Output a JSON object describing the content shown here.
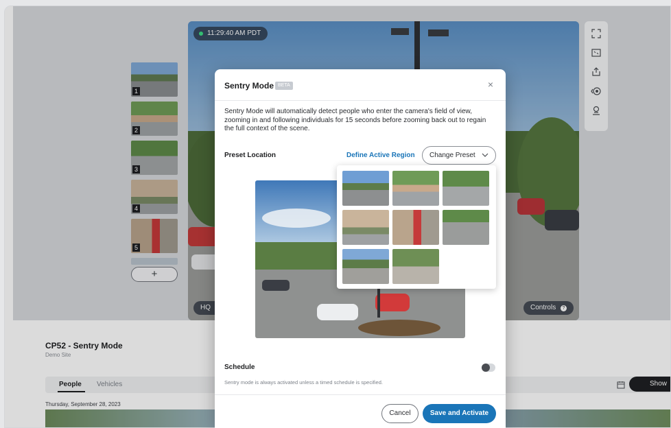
{
  "feed": {
    "timestamp": "11:29:40 AM PDT",
    "quality_label": "HQ",
    "controls_label": "Controls"
  },
  "presets": {
    "thumbs": [
      {
        "number": "1"
      },
      {
        "number": "2"
      },
      {
        "number": "3"
      },
      {
        "number": "4"
      },
      {
        "number": "5"
      }
    ],
    "add_label": "+"
  },
  "camera": {
    "title": "CP52 - Sentry Mode",
    "site": "Demo Site"
  },
  "tabs": {
    "people": "People",
    "vehicles": "Vehicles",
    "date": "Thursday, September 28, 2023",
    "show_label": "Show"
  },
  "modal": {
    "title": "Sentry Mode",
    "badge": "BETA",
    "close_symbol": "×",
    "description": "Sentry Mode will automatically detect people who enter the camera's field of view, zooming in and following individuals for 15 seconds before zooming back out to regain the full context of the scene.",
    "preset_location_label": "Preset Location",
    "define_region_link": "Define Active Region",
    "change_preset_label": "Change Preset",
    "schedule_label": "Schedule",
    "schedule_enabled": false,
    "schedule_note": "Sentry mode is always activated unless a timed schedule is specified.",
    "cancel_label": "Cancel",
    "save_label": "Save and Activate"
  },
  "dropdown": {
    "preset_count": 8
  },
  "colors": {
    "accent": "#1a75b8",
    "live_dot": "#3ddc84",
    "dark_pill": "#1f2023"
  },
  "icons": {
    "toolrail": [
      "expand-icon",
      "fit-screen-icon",
      "share-icon",
      "ptz-control-icon",
      "sentry-mode-icon"
    ]
  }
}
